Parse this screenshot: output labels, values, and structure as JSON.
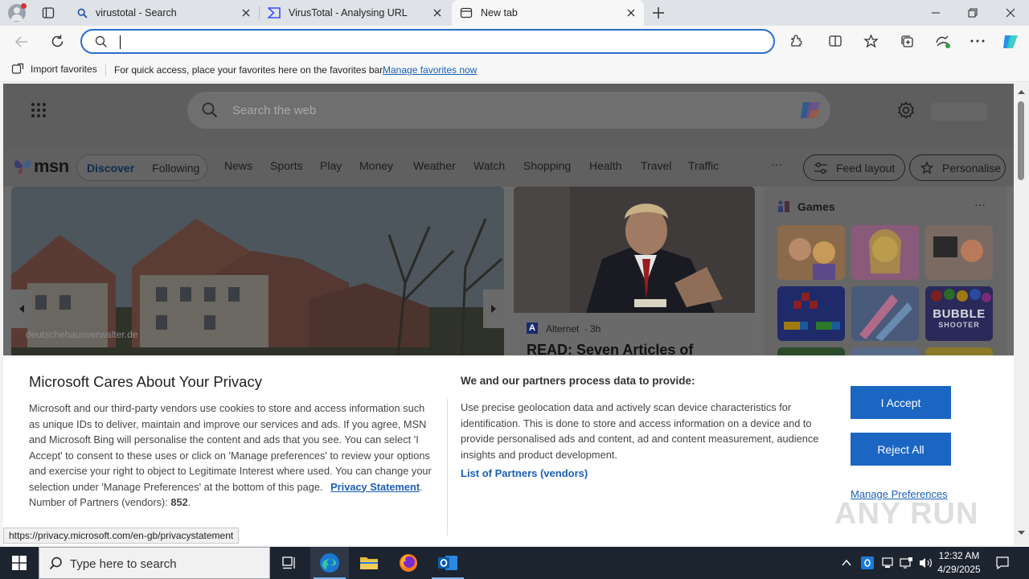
{
  "tabs": [
    {
      "title": "virustotal - Search"
    },
    {
      "title": "VirusTotal - Analysing URL"
    },
    {
      "title": "New tab"
    }
  ],
  "toolbar": {
    "address_value": ""
  },
  "favorites_bar": {
    "import_label": "Import favorites",
    "hint": "For quick access, place your favorites here on the favorites bar.",
    "manage_link": "Manage favorites now"
  },
  "msn": {
    "search_placeholder": "Search the web",
    "logo_text": "msn",
    "tabs": [
      "Discover",
      "Following"
    ],
    "nav": [
      "News",
      "Sports",
      "Play",
      "Money",
      "Weather",
      "Watch",
      "Shopping",
      "Health",
      "Travel",
      "Traffic"
    ],
    "more": "···",
    "feed_layout": "Feed layout",
    "personalise": "Personalise",
    "hero_source": "deutschehausverwalter.de",
    "article_source": "Alternet",
    "article_age": "3h",
    "article_headline": "READ: Seven Articles of",
    "games_title": "Games",
    "games_more": "···",
    "bubble_line1": "BUBBLE",
    "bubble_line2": "SHOOTER"
  },
  "privacy": {
    "title": "Microsoft Cares About Your Privacy",
    "para": "Microsoft and our third-party vendors use cookies to store and access information such as unique IDs to deliver, maintain and improve our services and ads. If you agree, MSN and Microsoft Bing will personalise the content and ads that you see. You can select 'I Accept' to consent to these uses or click on 'Manage preferences' to review your options and exercise your right to object to Legitimate Interest where used.  You can change your selection under 'Manage Preferences' at the bottom of this page.",
    "privacy_link": "Privacy Statement",
    "partners_label": "Number of Partners (vendors):",
    "partners_count": "852",
    "right_title": "We and our partners process data to provide:",
    "right_para": "Use precise geolocation data and actively scan device characteristics for identification. This is done to store and access information on a device and to provide personalised ads and content, ad and content measurement, audience insights and product development.",
    "partners_link": "List of Partners (vendors)",
    "accept": "I Accept",
    "reject": "Reject All",
    "manage": "Manage Preferences"
  },
  "status_url": "https://privacy.microsoft.com/en-gb/privacystatement",
  "taskbar": {
    "search_placeholder": "Type here to search",
    "time": "12:32 AM",
    "date": "4/29/2025"
  },
  "watermark": "ANY RUN"
}
